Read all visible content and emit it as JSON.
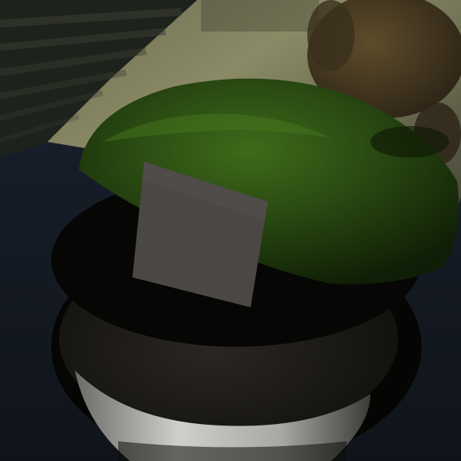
{
  "image": {
    "kind": "rendered-3d-scene",
    "subjects": [
      "floor",
      "rug",
      "bowl",
      "green-cap",
      "label-patch",
      "pedestal",
      "potted-plant"
    ],
    "colors": {
      "floor_light": "#8a8a66",
      "floor_shadow": "#1c2430",
      "rug_stripe": "#2c3026",
      "cap_green": "#1f3a0f",
      "cap_highlight": "#3f6a1a",
      "bowl_dark": "#1d1b18",
      "bowl_rim": "#090806",
      "patch_gray": "#4a4744",
      "pedestal_white": "#c8c8c2",
      "plant_brown": "#4e3f24"
    }
  }
}
